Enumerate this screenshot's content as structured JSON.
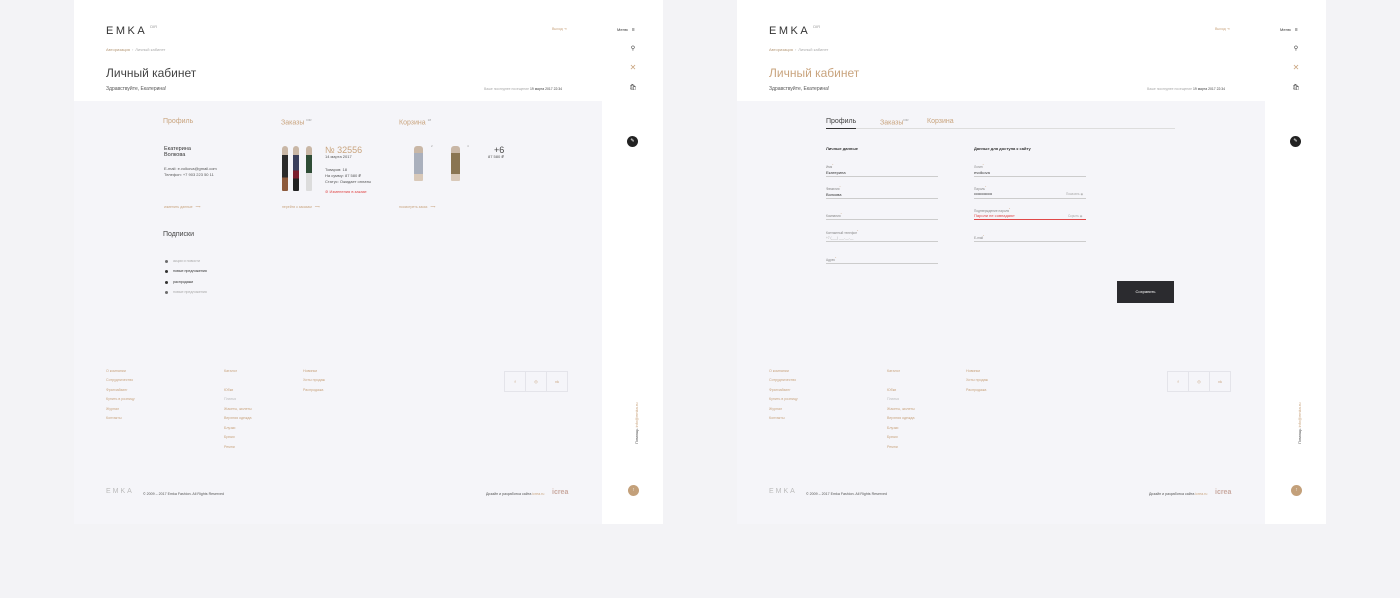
{
  "colors": {
    "accent": "#c9a47e",
    "dark": "#2b2b2f",
    "error": "#e04848",
    "bg": "#f3f3f6",
    "content_bg": "#f5f5f9"
  },
  "brand": {
    "logo": "EMKA",
    "logo_sup": "DIR"
  },
  "header": {
    "enter_label": "Выход",
    "menu_label": "Меню",
    "breadcrumb": [
      "Авторизация",
      "Личный кабинет"
    ],
    "page_title": "Личный кабинет",
    "greeting": "Здравствуйте, Екатерина!",
    "last_visit_label": "Ваше последнее посещение",
    "last_visit_value": "19 марта 2017 22:34"
  },
  "icons": {
    "menu": "hamburger-icon",
    "search": "search-icon",
    "close": "close-icon",
    "cart": "cart-icon",
    "edit": "pencil-icon",
    "up": "arrow-up-icon",
    "facebook": "facebook-icon",
    "instagram": "instagram-icon",
    "vk": "vk-icon"
  },
  "overview": {
    "profile": {
      "heading": "Профиль",
      "first_name": "Екатерина",
      "last_name": "Волкова",
      "email_label": "E-mail:",
      "email": "e.volkova@gmail.com",
      "phone_label": "Телефон:",
      "phone": "+7 903 223 50 11",
      "link": "изменить данные"
    },
    "orders": {
      "heading": "Заказы",
      "sup": "DIR",
      "number": "№ 32556",
      "date": "14 марта 2017",
      "items_label": "Товаров:",
      "items": "18",
      "sum_label": "На сумму:",
      "sum": "87 580 ₽",
      "status_label": "Статус:",
      "status": "Ожидает оплаты",
      "change_note": "Изменения в заказе",
      "link": "перейти к заказам"
    },
    "cart": {
      "heading": "Корзина",
      "sup": "18",
      "more": "+6",
      "more_sum": "87 580 ₽",
      "badge1": "2",
      "badge2": "4",
      "link": "посмотреть заказ"
    },
    "subscriptions": {
      "heading": "Подписки",
      "items": [
        {
          "label": "акции и новости",
          "on": false
        },
        {
          "label": "новые предложения",
          "on": true
        },
        {
          "label": "распродажи",
          "on": true
        },
        {
          "label": "новые предложения",
          "on": false
        }
      ]
    }
  },
  "profile_form": {
    "tabs": [
      "Профиль",
      "Заказы",
      "Корзина"
    ],
    "tab_sup": "DIR",
    "personal_heading": "Личные данные",
    "access_heading": "Данные для доступа к сайту",
    "name_label": "Имя",
    "name_value": "Екатерина",
    "surname_label": "Фамилия",
    "surname_value": "Волкова",
    "company_label": "Компания",
    "phone_label": "Контактный телефон",
    "phone_placeholder": "+7 (___) ___-__-__",
    "address_label": "Адрес",
    "login_label": "Логин",
    "login_value": "evolkova",
    "password_label": "Пароль",
    "password_value": "•••••••••••••••",
    "password_side": "Показать",
    "confirm_label": "Подтверждение пароля",
    "confirm_error": "Пароли не совпадают",
    "confirm_side": "Скрыть",
    "email_label": "E-mail",
    "save_button": "Сохранить"
  },
  "footer": {
    "col1": [
      "О компании",
      "Сотрудничество",
      "Франчайзинг",
      "Купить в розницу",
      "Журнал",
      "Контакты"
    ],
    "col2_title": "Каталог",
    "col2": [
      "Юбки",
      "Платья",
      "Жакеты, жилеты",
      "Верхняя одежда",
      "Блузки",
      "Брюки",
      "Ремни"
    ],
    "col3": [
      "Новинки",
      "Хиты продаж",
      "Распродажа"
    ],
    "social": [
      "f",
      "◎",
      "vk"
    ],
    "logo": "EMKA",
    "copyright": "© 2009 – 2017 Emka Fashion. All Rights Reserved",
    "design_label": "Дизайн и разработка сайта",
    "design_link": "icrea.ru",
    "studio": "icrea"
  },
  "rail": {
    "vertical_label": "Помощь",
    "vertical_link": "info@emka.ru"
  }
}
